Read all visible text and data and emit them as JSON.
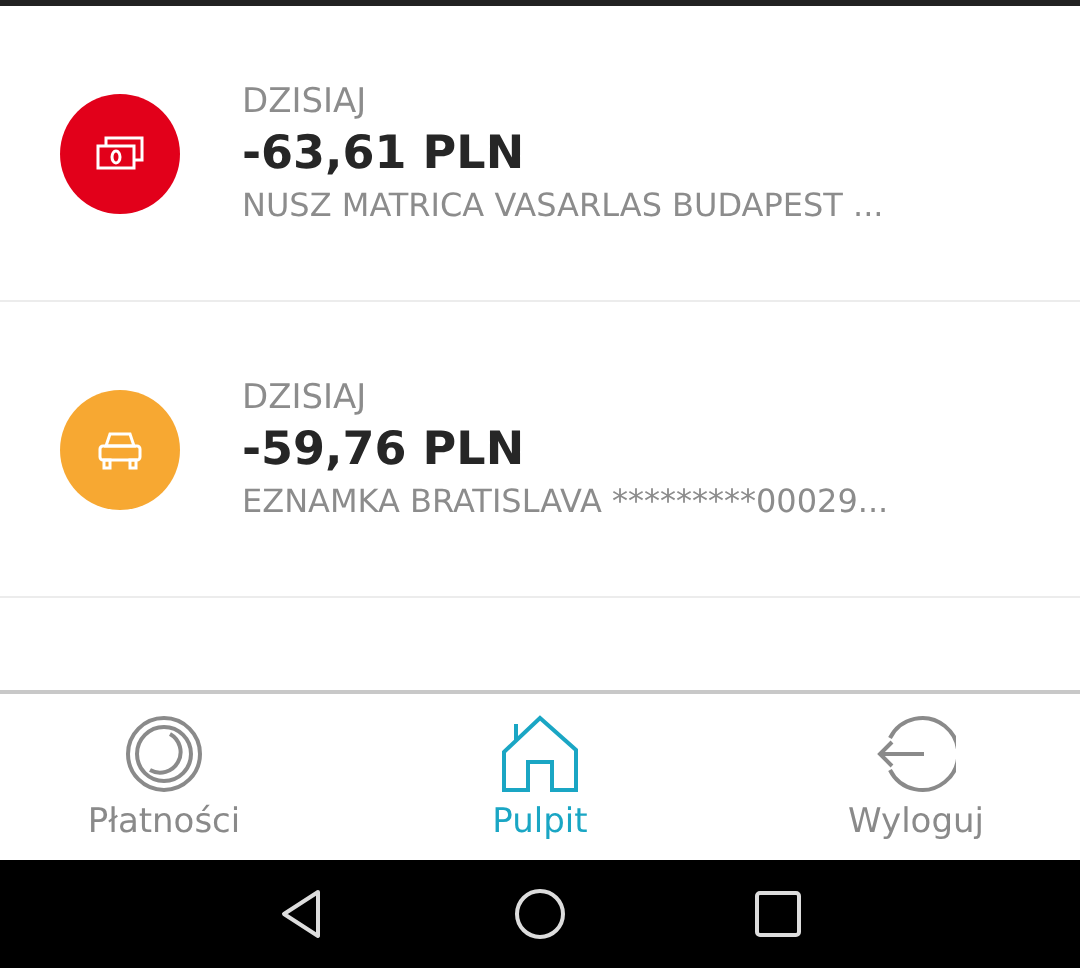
{
  "transactions": [
    {
      "kind": "cash",
      "color": "#e2001a",
      "date": "DZISIAJ",
      "amount": "-63,61 PLN",
      "description": "NUSZ MATRICA VASARLAS BUDAPEST ..."
    },
    {
      "kind": "car",
      "color": "#f7a832",
      "date": "DZISIAJ",
      "amount": "-59,76 PLN",
      "description": "EZNAMKA BRATISLAVA *********00029..."
    }
  ],
  "nav": [
    {
      "kind": "payments",
      "label": "Płatności",
      "selected": false
    },
    {
      "kind": "home",
      "label": "Pulpit",
      "selected": true
    },
    {
      "kind": "logout",
      "label": "Wyloguj",
      "selected": false
    }
  ]
}
